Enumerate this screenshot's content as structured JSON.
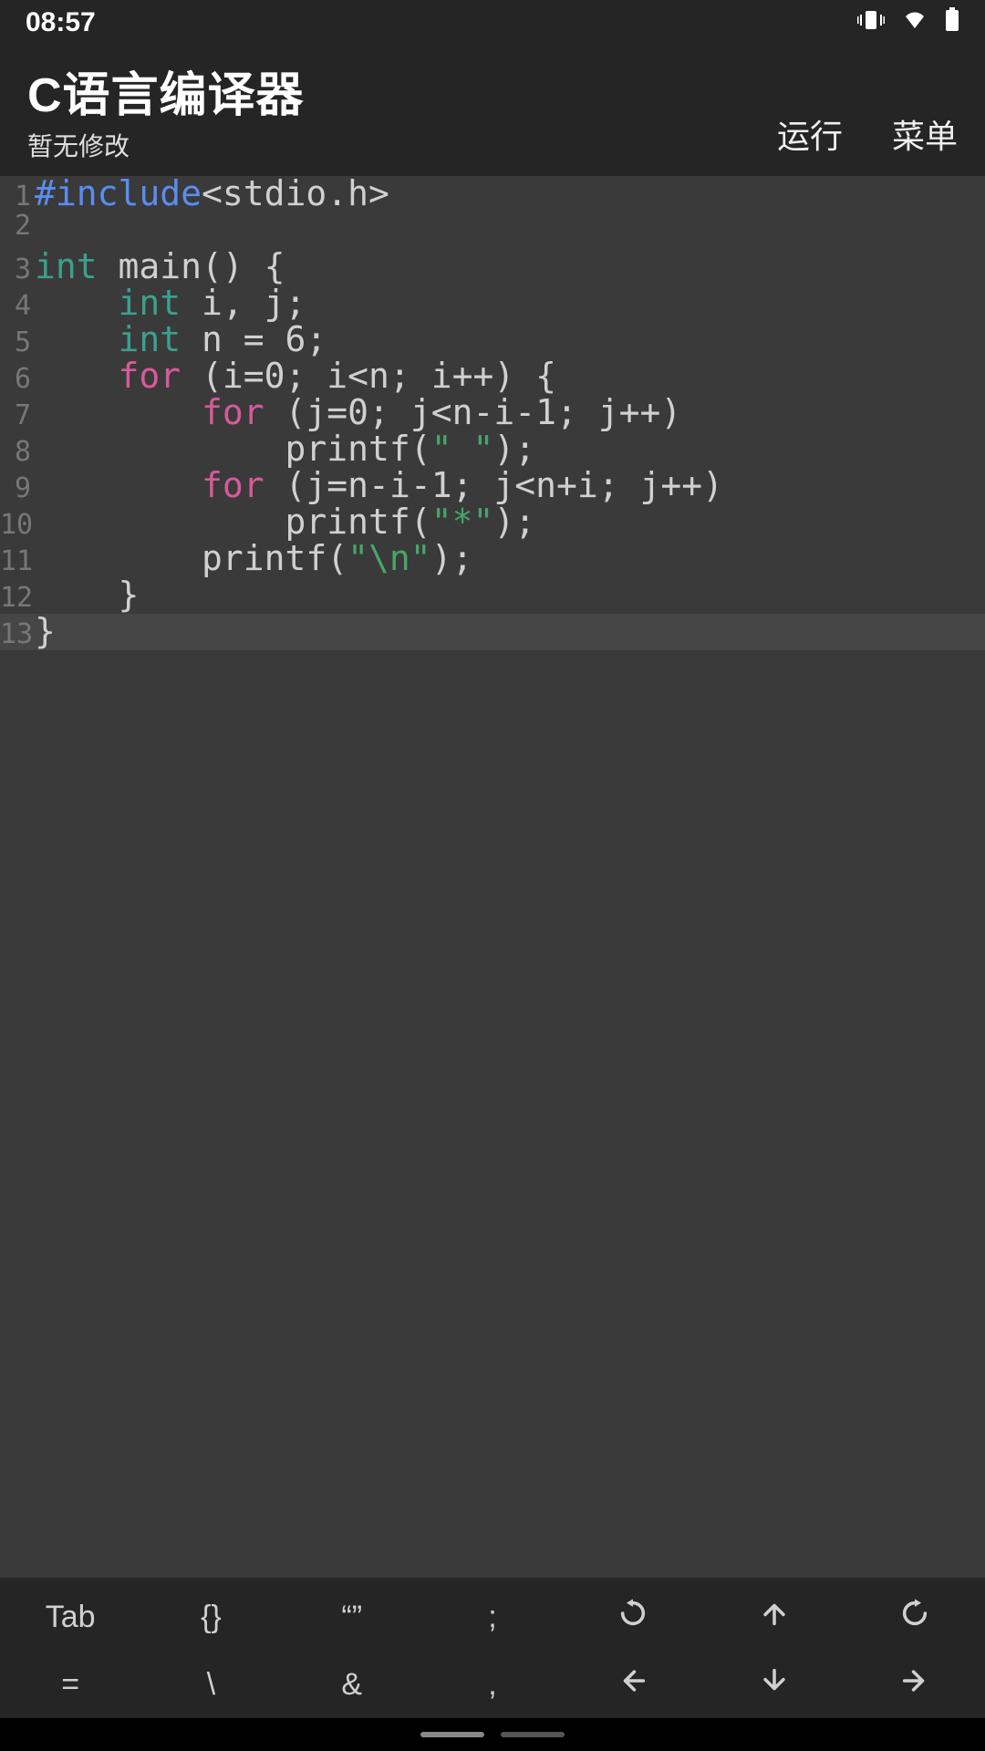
{
  "status": {
    "time": "08:57"
  },
  "app": {
    "title": "C语言编译器",
    "subtitle": "暂无修改",
    "run": "运行",
    "menu": "菜单"
  },
  "active_line": 13,
  "code": [
    {
      "n": "1",
      "tokens": [
        [
          "kw-blue",
          "#include"
        ],
        [
          "",
          "<stdio.h>"
        ]
      ]
    },
    {
      "n": "2",
      "tokens": [
        [
          "",
          ""
        ]
      ]
    },
    {
      "n": "3",
      "tokens": [
        [
          "kw-teal",
          "int"
        ],
        [
          "",
          " main() {"
        ]
      ]
    },
    {
      "n": "4",
      "tokens": [
        [
          "",
          "    "
        ],
        [
          "kw-teal",
          "int"
        ],
        [
          "",
          " i, j;"
        ]
      ]
    },
    {
      "n": "5",
      "tokens": [
        [
          "",
          "    "
        ],
        [
          "kw-teal",
          "int"
        ],
        [
          "",
          " n = 6;"
        ]
      ]
    },
    {
      "n": "6",
      "tokens": [
        [
          "",
          "    "
        ],
        [
          "kw-pink",
          "for"
        ],
        [
          "",
          " (i=0; i<n; i++) {"
        ]
      ]
    },
    {
      "n": "7",
      "tokens": [
        [
          "",
          "        "
        ],
        [
          "kw-pink",
          "for"
        ],
        [
          "",
          " (j=0; j<n-i-1; j++)"
        ]
      ]
    },
    {
      "n": "8",
      "tokens": [
        [
          "",
          "            printf("
        ],
        [
          "str",
          "\" \""
        ],
        [
          "",
          ");"
        ]
      ]
    },
    {
      "n": "9",
      "tokens": [
        [
          "",
          "        "
        ],
        [
          "kw-pink",
          "for"
        ],
        [
          "",
          " (j=n-i-1; j<n+i; j++)"
        ]
      ]
    },
    {
      "n": "10",
      "tokens": [
        [
          "",
          "            printf("
        ],
        [
          "str",
          "\"*\""
        ],
        [
          "",
          ");"
        ]
      ]
    },
    {
      "n": "11",
      "tokens": [
        [
          "",
          "        printf("
        ],
        [
          "str",
          "\"\\n\""
        ],
        [
          "",
          ");"
        ]
      ]
    },
    {
      "n": "12",
      "tokens": [
        [
          "",
          "    }"
        ]
      ]
    },
    {
      "n": "13",
      "tokens": [
        [
          "",
          "}"
        ]
      ]
    }
  ],
  "toolbar": {
    "row1": [
      "Tab",
      "{}",
      "“”",
      ";",
      "undo-icon",
      "up-icon",
      "redo-icon"
    ],
    "row2": [
      "=",
      "\\",
      "&",
      ",",
      "left-icon",
      "down-icon",
      "right-icon"
    ]
  }
}
